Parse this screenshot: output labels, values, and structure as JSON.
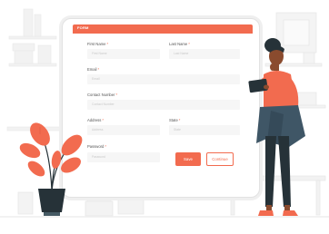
{
  "form": {
    "title": "FORM",
    "fields": {
      "first_name": {
        "label": "First Name",
        "placeholder": "First Name"
      },
      "last_name": {
        "label": "Last Name",
        "placeholder": "Last Name"
      },
      "email": {
        "label": "Email",
        "placeholder": "Email"
      },
      "contact": {
        "label": "Contact Number",
        "placeholder": "Contact Number"
      },
      "address": {
        "label": "Address",
        "placeholder": "Address"
      },
      "state": {
        "label": "State",
        "placeholder": "State"
      },
      "password": {
        "label": "Password",
        "placeholder": "Password"
      }
    },
    "required_marker": "*",
    "buttons": {
      "save": "Save",
      "continue": "Continue"
    }
  },
  "colors": {
    "accent": "#f26b4f",
    "field_bg": "#f6f6f6",
    "skin": "#8a4b2e",
    "scarf": "#3f5666",
    "pants": "#263238"
  },
  "illustration": {
    "woman_holding_tablet": "person-illustration",
    "plant": "potted-plant",
    "shelves": "bookshelf",
    "frame": "picture-frame"
  }
}
